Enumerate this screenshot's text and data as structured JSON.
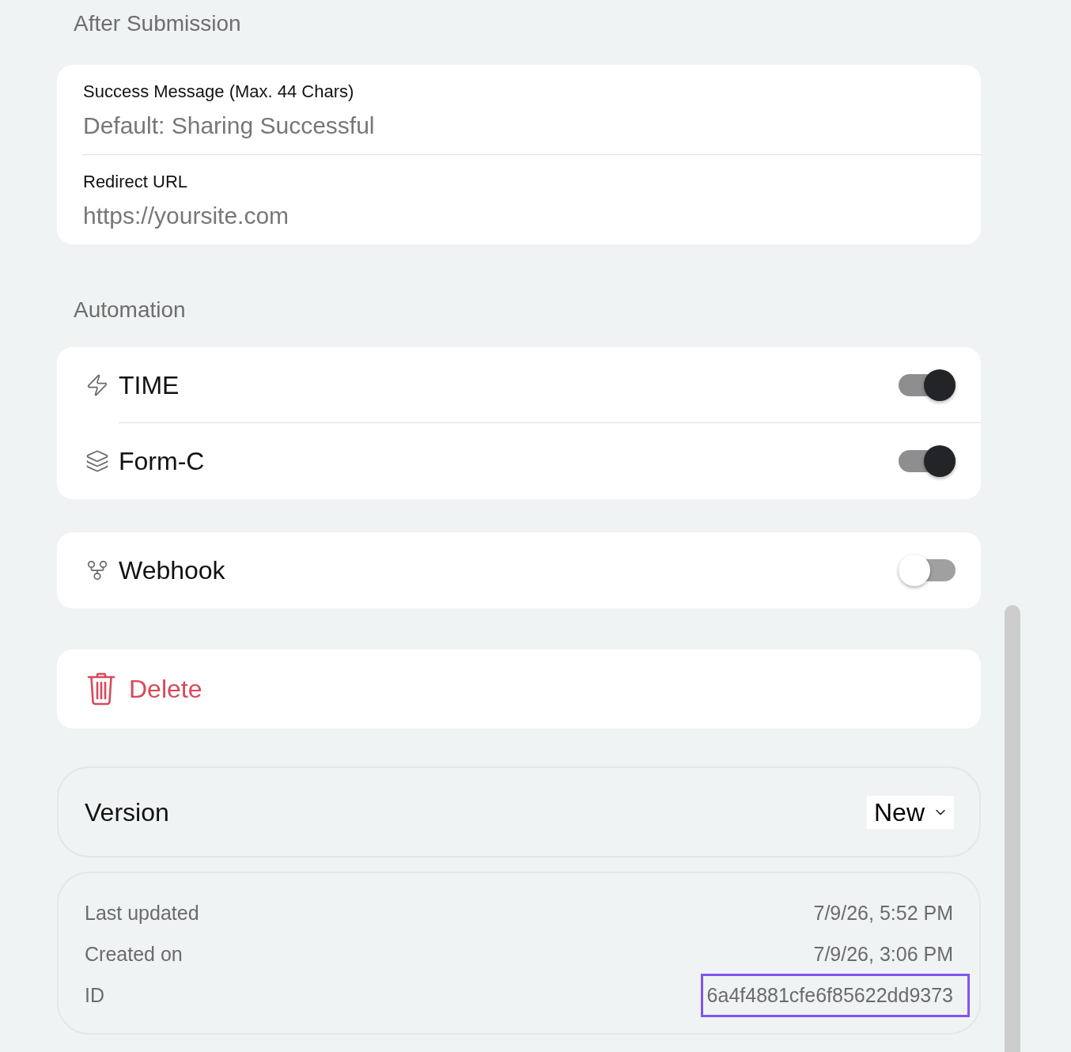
{
  "after_submission": {
    "heading": "After Submission",
    "fields": [
      {
        "label": "Success Message (Max. 44 Chars)",
        "placeholder": "Default: Sharing Successful"
      },
      {
        "label": "Redirect URL",
        "placeholder": "https://yoursite.com"
      }
    ]
  },
  "automation": {
    "heading": "Automation",
    "groups": [
      {
        "items": [
          {
            "label": "TIME",
            "on": true
          },
          {
            "label": "Form-C",
            "on": true
          }
        ]
      },
      {
        "items": [
          {
            "label": "Webhook",
            "on": false
          }
        ]
      }
    ]
  },
  "delete": {
    "label": "Delete"
  },
  "version": {
    "label": "Version",
    "value": "New"
  },
  "info": {
    "rows": [
      {
        "label": "Last updated",
        "value": "7/9/26, 5:52 PM",
        "highlighted": false
      },
      {
        "label": "Created on",
        "value": "7/9/26, 3:06 PM",
        "highlighted": false
      },
      {
        "label": "ID",
        "value": "6a4f4881cfe6f85622dd9373",
        "highlighted": true
      }
    ]
  }
}
